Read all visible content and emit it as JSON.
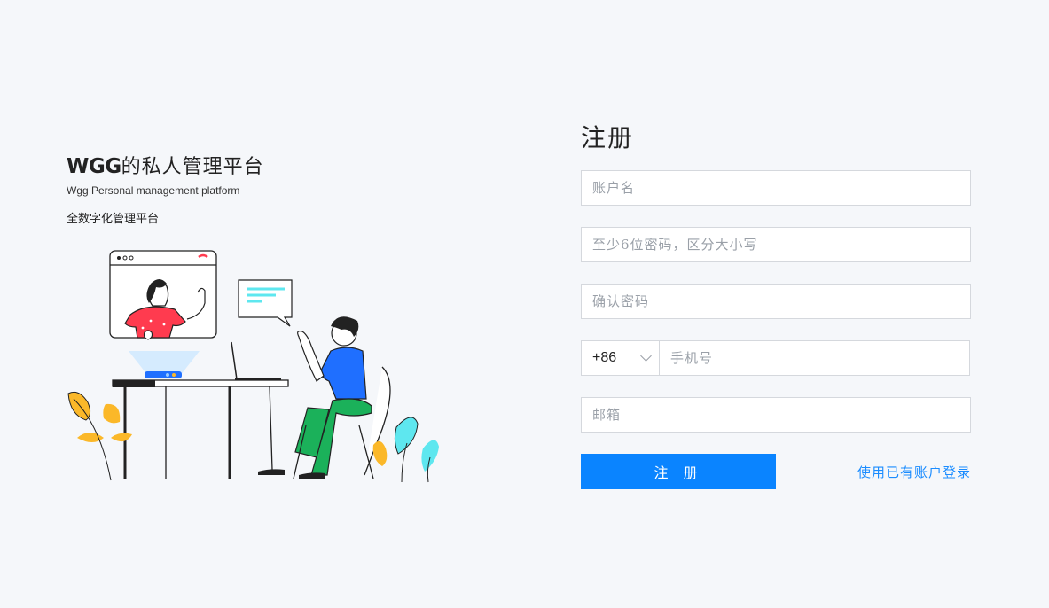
{
  "brand": {
    "title_latin": "WGG",
    "title_cn": "的私人管理平台",
    "subtitle": "Wgg Personal management platform",
    "description": "全数字化管理平台"
  },
  "form": {
    "title": "注册",
    "username_placeholder": "账户名",
    "password_placeholder": "至少6位密码，区分大小写",
    "confirm_placeholder": "确认密码",
    "country_code": "+86",
    "phone_placeholder": "手机号",
    "email_placeholder": "邮箱",
    "submit_label": "注 册",
    "login_link": "使用已有账户登录"
  },
  "colors": {
    "primary": "#0a84ff",
    "link": "#1a8cff",
    "background": "#f5f7fa",
    "shirt_red": "#ff3b4f",
    "shirt_blue": "#1f6fff",
    "pants_green": "#1bb15a",
    "leaf_orange": "#fbb829",
    "leaf_cyan": "#5ee7ef"
  },
  "icons": {
    "dropdown": "chevron-down-icon",
    "illustration": "video-call-illustration"
  }
}
